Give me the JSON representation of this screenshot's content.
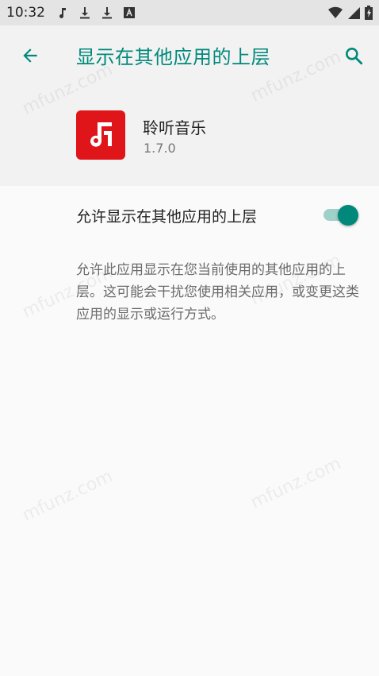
{
  "status_bar": {
    "time": "10:32",
    "icons": [
      "music-note-icon",
      "download-icon",
      "download-icon",
      "font-icon"
    ],
    "right_icons": [
      "wifi-icon",
      "signal-icon",
      "battery-icon"
    ]
  },
  "header": {
    "title": "显示在其他应用的上层",
    "back_icon": "arrow-back-icon",
    "search_icon": "search-icon"
  },
  "app": {
    "name": "聆听音乐",
    "version": "1.7.0",
    "icon_color": "#e0151a"
  },
  "permission": {
    "label": "允许显示在其他应用的上层",
    "enabled": true,
    "description": "允许此应用显示在您当前使用的其他应用的上层。这可能会干扰您使用相关应用，或变更这类应用的显示或运行方式。"
  },
  "watermark": "mfunz.com",
  "colors": {
    "accent": "#00897b",
    "status_bar_bg": "#e4e4e4",
    "header_bg": "#f2f2f2"
  }
}
